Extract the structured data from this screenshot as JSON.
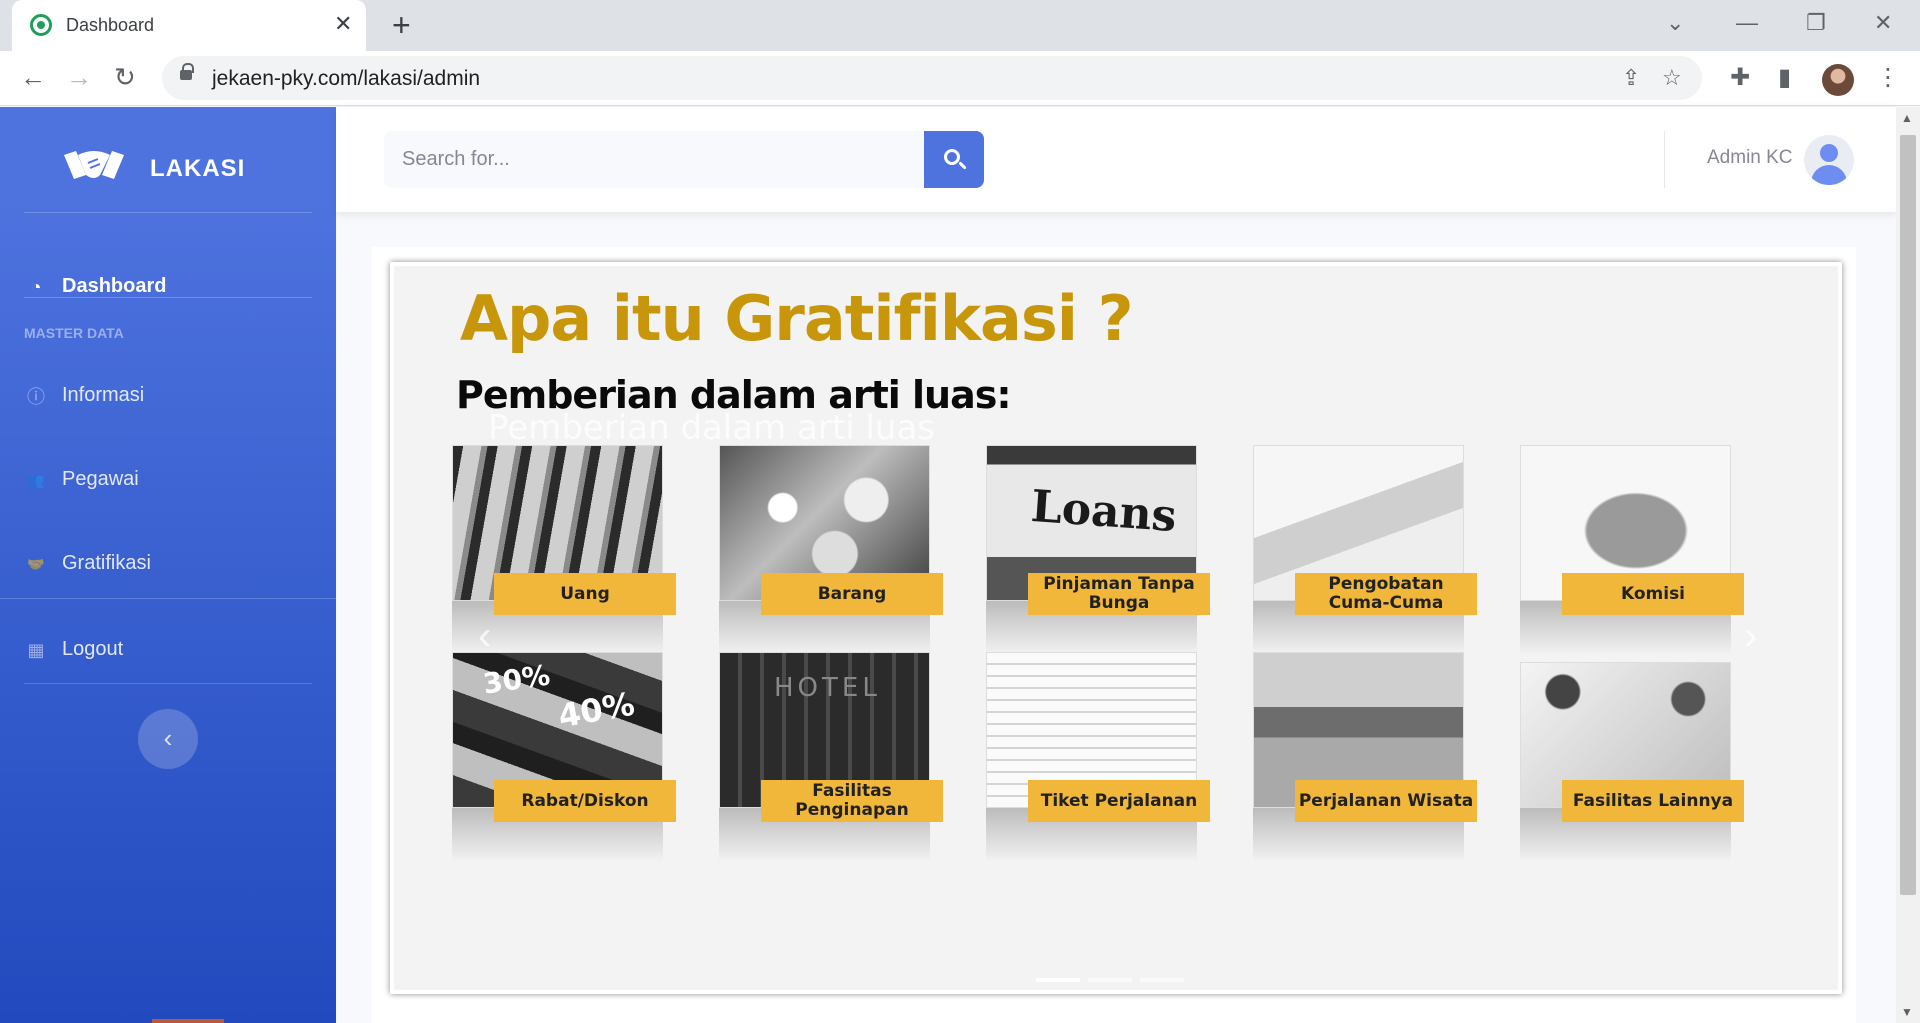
{
  "browser": {
    "tab_title": "Dashboard",
    "tab_close": "✕",
    "new_tab": "+",
    "url": "jekaen-pky.com/lakasi/admin",
    "win_controls": {
      "chevron": "⌄",
      "minimize": "—",
      "restore": "❐",
      "close": "✕"
    },
    "nav": {
      "back": "←",
      "forward": "→",
      "reload": "↻"
    },
    "icons": {
      "share": "⇪",
      "star": "☆",
      "extensions": "✚",
      "sidepanel": "▮",
      "menu": "⋮"
    }
  },
  "sidebar": {
    "brand": "LAKASI",
    "heading": "MASTER DATA",
    "items": [
      {
        "label": "Dashboard",
        "icon": "tachometer-icon",
        "glyph": "◔",
        "active": true
      },
      {
        "label": "Informasi",
        "icon": "info-circle-icon",
        "glyph": "ⓘ",
        "active": false
      },
      {
        "label": "Pegawai",
        "icon": "users-icon",
        "glyph": "👥",
        "active": false
      },
      {
        "label": "Gratifikasi",
        "icon": "handshake-icon",
        "glyph": "🤝",
        "active": false
      },
      {
        "label": "Logout",
        "icon": "table-icon",
        "glyph": "▦",
        "active": false
      }
    ],
    "toggle_glyph": "‹"
  },
  "topbar": {
    "search_placeholder": "Search for...",
    "user_name": "Admin KC"
  },
  "carousel": {
    "slide_title": "Apa itu Gratifikasi ?",
    "slide_subtitle": "Pemberian dalam arti luas:",
    "caption_overlay": "Pemberian dalam arti luas",
    "tiles": [
      {
        "label": "Uang"
      },
      {
        "label": "Barang"
      },
      {
        "label": "Pinjaman Tanpa Bunga"
      },
      {
        "label": "Pengobatan Cuma-Cuma"
      },
      {
        "label": "Komisi"
      },
      {
        "label": "Rabat/Diskon"
      },
      {
        "label": "Fasilitas Penginapan"
      },
      {
        "label": "Tiket Perjalanan"
      },
      {
        "label": "Perjalanan Wisata"
      },
      {
        "label": "Fasilitas Lainnya"
      }
    ],
    "image_text": {
      "loans": "Loans",
      "hotel": "HOTEL",
      "d30": "30%",
      "d40": "40%"
    },
    "prev_glyph": "‹",
    "next_glyph": "›",
    "slide_count": 3,
    "active_slide": 1
  },
  "colors": {
    "sidebar_top": "#4e73df",
    "sidebar_bottom": "#224abe",
    "title_gold": "#c8960a",
    "label_yellow": "#f0b73a"
  }
}
